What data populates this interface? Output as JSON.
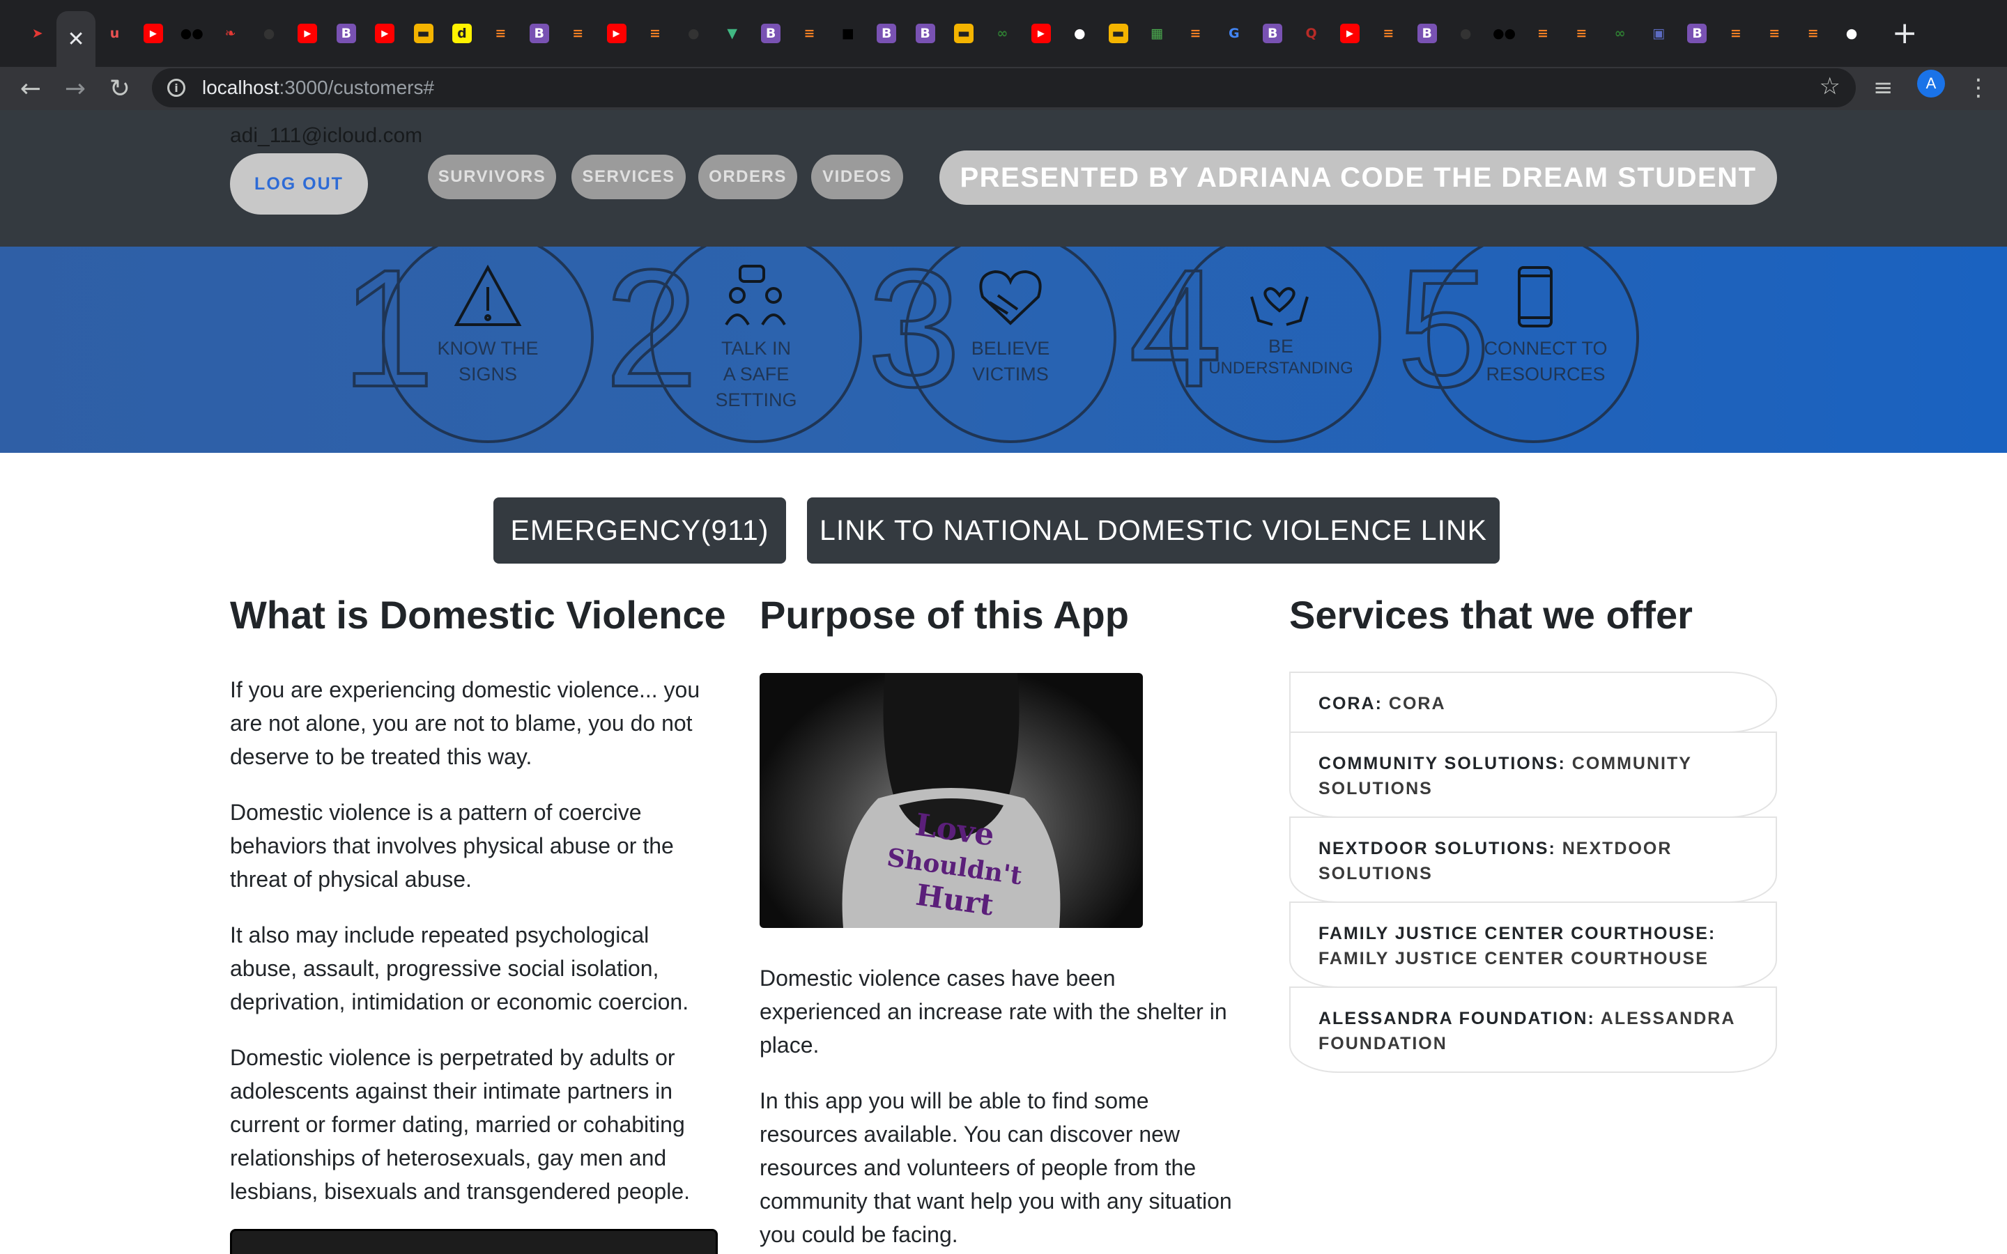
{
  "browser": {
    "tabs": [
      {
        "icon": "arrow-favicon-icon",
        "color": "#e53935"
      },
      {
        "icon": "close-icon",
        "active": true
      },
      {
        "icon": "udemy-icon",
        "color": "#ec5252"
      },
      {
        "icon": "youtube-icon",
        "color": "#ff0000"
      },
      {
        "icon": "medium-icon",
        "color": "#000000"
      },
      {
        "icon": "bird-icon",
        "color": "#e53935"
      },
      {
        "icon": "github-icon",
        "color": "#333333"
      },
      {
        "icon": "youtube-icon",
        "color": "#ff0000"
      },
      {
        "icon": "bootstrap-icon",
        "color": "#7952b3"
      },
      {
        "icon": "youtube-icon",
        "color": "#ff0000"
      },
      {
        "icon": "slides-icon",
        "color": "#f4b400"
      },
      {
        "icon": "dictionary-icon",
        "color": "#fff200"
      },
      {
        "icon": "stackoverflow-icon",
        "color": "#f48024"
      },
      {
        "icon": "bootstrap-icon",
        "color": "#7952b3"
      },
      {
        "icon": "stackoverflow-icon",
        "color": "#f48024"
      },
      {
        "icon": "youtube-icon",
        "color": "#ff0000"
      },
      {
        "icon": "stackoverflow-icon",
        "color": "#f48024"
      },
      {
        "icon": "github-icon",
        "color": "#333333"
      },
      {
        "icon": "vue-icon",
        "color": "#41b883"
      },
      {
        "icon": "bootstrap-icon",
        "color": "#7952b3"
      },
      {
        "icon": "stackoverflow-icon",
        "color": "#f48024"
      },
      {
        "icon": "square-icon",
        "color": "#000000"
      },
      {
        "icon": "bootstrap-icon",
        "color": "#7952b3"
      },
      {
        "icon": "bootstrap-icon",
        "color": "#7952b3"
      },
      {
        "icon": "slides-icon",
        "color": "#f4b400"
      },
      {
        "icon": "link-icon",
        "color": "#2e7d32"
      },
      {
        "icon": "youtube-icon",
        "color": "#ff0000"
      },
      {
        "icon": "github-icon",
        "color": "#ffffff"
      },
      {
        "icon": "slides-icon",
        "color": "#f4b400"
      },
      {
        "icon": "sheets-icon",
        "color": "#4caf50"
      },
      {
        "icon": "stackoverflow-icon",
        "color": "#f48024"
      },
      {
        "icon": "google-icon",
        "color": "#4285f4"
      },
      {
        "icon": "bootstrap-icon",
        "color": "#7952b3"
      },
      {
        "icon": "quora-icon",
        "color": "#b92b27"
      },
      {
        "icon": "youtube-icon",
        "color": "#ff0000"
      },
      {
        "icon": "stackoverflow-icon",
        "color": "#f48024"
      },
      {
        "icon": "bootstrap-icon",
        "color": "#7952b3"
      },
      {
        "icon": "github-icon",
        "color": "#333333"
      },
      {
        "icon": "medium-icon",
        "color": "#000000"
      },
      {
        "icon": "stackoverflow-icon",
        "color": "#f48024"
      },
      {
        "icon": "stackoverflow-icon",
        "color": "#f48024"
      },
      {
        "icon": "link-icon",
        "color": "#2e7d32"
      },
      {
        "icon": "image-icon",
        "color": "#5c6bc0"
      },
      {
        "icon": "bootstrap-icon",
        "color": "#7952b3"
      },
      {
        "icon": "stackoverflow-icon",
        "color": "#f48024"
      },
      {
        "icon": "stackoverflow-icon",
        "color": "#f48024"
      },
      {
        "icon": "stackoverflow-icon",
        "color": "#f48024"
      },
      {
        "icon": "github-icon",
        "color": "#ffffff"
      }
    ],
    "url_host": "localhost",
    "url_path": ":3000/customers#",
    "profile_initial": "A"
  },
  "header": {
    "email": "adi_111@icloud.com",
    "logout_label": "LOG OUT",
    "nav": [
      {
        "label": "SURVIVORS"
      },
      {
        "label": "SERVICES"
      },
      {
        "label": "ORDERS"
      },
      {
        "label": "VIDEOS"
      }
    ],
    "presented_label": "PRESENTED BY ADRIANA CODE THE DREAM STUDENT"
  },
  "banner": {
    "steps": [
      {
        "number": "1",
        "lines": [
          "KNOW THE",
          "SIGNS"
        ],
        "icon": "warning-icon"
      },
      {
        "number": "2",
        "lines": [
          "TALK IN",
          "A SAFE",
          "SETTING"
        ],
        "icon": "people-talking-icon"
      },
      {
        "number": "3",
        "lines": [
          "BELIEVE",
          "VICTIMS"
        ],
        "icon": "handshake-heart-icon"
      },
      {
        "number": "4",
        "lines": [
          "BE",
          "UNDERSTANDING"
        ],
        "icon": "hands-heart-icon"
      },
      {
        "number": "5",
        "lines": [
          "CONNECT TO",
          "RESOURCES"
        ],
        "icon": "phone-icon"
      }
    ]
  },
  "actions": {
    "emergency_label": "EMERGENCY(911)",
    "national_link_label": "LINK TO NATIONAL DOMESTIC VIOLENCE LINK"
  },
  "what_is": {
    "title": "What is Domestic Violence",
    "paragraphs": [
      [
        "If you are experiencing domestic violence... you",
        "are not alone, you are not to blame, you do not",
        "deserve to be treated this way."
      ],
      [
        "Domestic violence is a pattern of coercive",
        "behaviors that involves physical abuse or the",
        "threat of physical abuse."
      ],
      [
        "It also may include repeated psychological",
        "abuse, assault, progressive social isolation,",
        "deprivation, intimidation or economic coercion."
      ],
      [
        "Domestic violence is perpetrated by adults or",
        "adolescents against their intimate partners in",
        "current or former dating, married or cohabiting",
        "relationships of heterosexuals, gay men and",
        "lesbians, bisexuals and transgendered people."
      ]
    ]
  },
  "purpose": {
    "title": "Purpose of this App",
    "image_text": [
      "Love",
      "Shouldn't",
      "Hurt"
    ],
    "paragraphs": [
      [
        "Domestic violence cases have been",
        "experienced an increase rate with the shelter in",
        "place."
      ],
      [
        "In this app you will be able to find some",
        "resources available. You can discover new",
        "resources and volunteers of people from the",
        "community that want help you with any situation",
        "you could be facing."
      ]
    ]
  },
  "services": {
    "title": "Services that we offer",
    "items": [
      {
        "name": "CORA",
        "desc_lines": [
          "CORA"
        ]
      },
      {
        "name": "COMMUNITY SOLUTIONS",
        "desc_lines": [
          "COMMUNITY",
          "SOLUTIONS"
        ]
      },
      {
        "name": "NEXTDOOR SOLUTIONS",
        "desc_lines": [
          "NEXTDOOR",
          "SOLUTIONS"
        ]
      },
      {
        "name": "FAMILY JUSTICE CENTER COURTHOUSE",
        "desc_lines": [
          "FAMILY JUSTICE CENTER COURTHOUSE"
        ]
      },
      {
        "name": "ALESSANDRA FOUNDATION",
        "desc_lines": [
          "ALESSANDRA",
          "FOUNDATION"
        ]
      }
    ]
  },
  "colors": {
    "header_bg": "#343a40",
    "banner_start": "#2f5fa6",
    "banner_end": "#1a62c0",
    "button_dark": "#343a40",
    "logout_text": "#2d6bd6"
  }
}
